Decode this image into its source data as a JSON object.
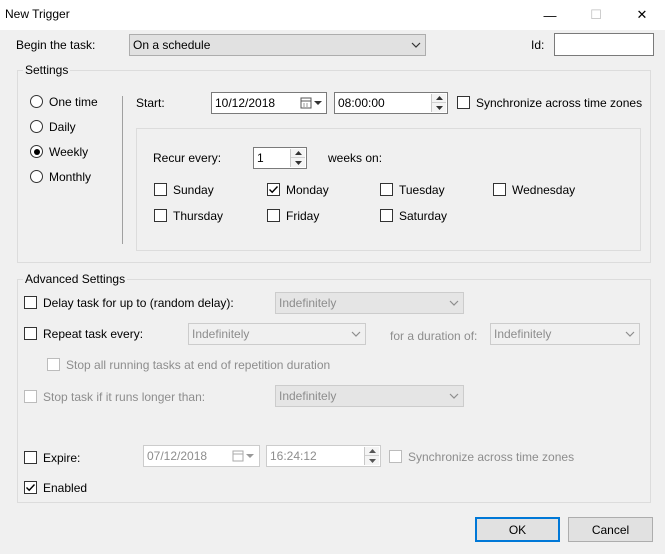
{
  "window": {
    "title": "New Trigger",
    "minimize_glyph": "—",
    "maximize_glyph": "☐",
    "close_glyph": "✕"
  },
  "begin": {
    "label": "Begin the task:",
    "value": "On a schedule",
    "id_label": "Id:",
    "id_value": ""
  },
  "settings": {
    "legend": "Settings",
    "radios": [
      {
        "label": "One time",
        "checked": false
      },
      {
        "label": "Daily",
        "checked": false
      },
      {
        "label": "Weekly",
        "checked": true
      },
      {
        "label": "Monthly",
        "checked": false
      }
    ],
    "start_label": "Start:",
    "start_date": "10/12/2018",
    "start_time": "08:00:00",
    "sync_label": "Synchronize across time zones",
    "sync_checked": false,
    "recur_label": "Recur every:",
    "recur_value": "1",
    "weeks_on_label": "weeks on:",
    "days": [
      {
        "label": "Sunday",
        "checked": false
      },
      {
        "label": "Monday",
        "checked": true
      },
      {
        "label": "Tuesday",
        "checked": false
      },
      {
        "label": "Wednesday",
        "checked": false
      },
      {
        "label": "Thursday",
        "checked": false
      },
      {
        "label": "Friday",
        "checked": false
      },
      {
        "label": "Saturday",
        "checked": false
      }
    ]
  },
  "advanced": {
    "legend": "Advanced Settings",
    "delay_label": "Delay task for up to (random delay):",
    "delay_value": "Indefinitely",
    "repeat_label": "Repeat task every:",
    "repeat_value": "Indefinitely",
    "duration_label": "for a duration of:",
    "duration_value": "Indefinitely",
    "stop_all_label": "Stop all running tasks at end of repetition duration",
    "stop_longer_label": "Stop task if it runs longer than:",
    "stop_longer_value": "Indefinitely",
    "expire_label": "Expire:",
    "expire_date": "07/12/2018",
    "expire_time": "16:24:12",
    "expire_sync_label": "Synchronize across time zones",
    "enabled_label": "Enabled",
    "enabled_checked": true
  },
  "buttons": {
    "ok": "OK",
    "cancel": "Cancel"
  }
}
